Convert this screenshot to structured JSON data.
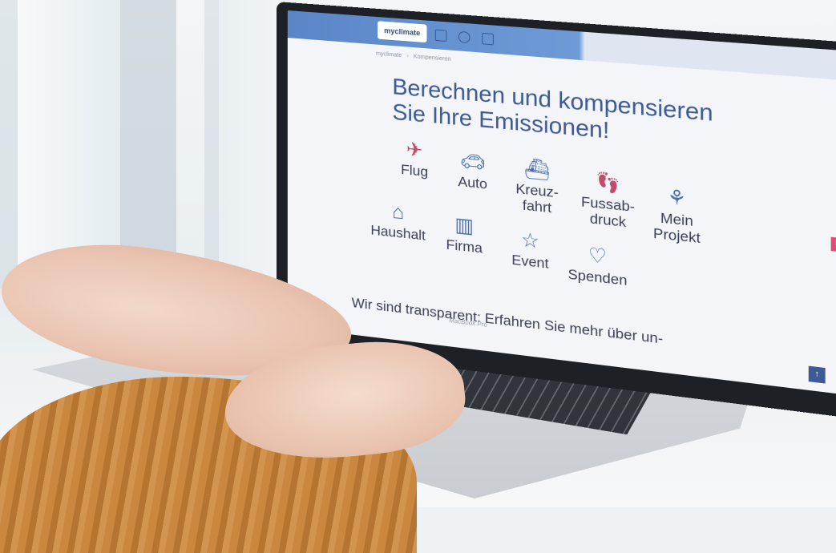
{
  "site": {
    "logo": "myclimate",
    "breadcrumb": [
      "myclimate",
      "Kompensieren"
    ],
    "heading_line1": "Berechnen und kompensieren",
    "heading_line2": "Sie Ihre Emissionen!",
    "categories": [
      {
        "label": "Flug",
        "icon": "airplane-icon"
      },
      {
        "label": "Auto",
        "icon": "car-icon"
      },
      {
        "label": "Kreuz-\nfahrt",
        "icon": "ship-icon"
      },
      {
        "label": "Fussab-\ndruck",
        "icon": "footprint-icon"
      },
      {
        "label": "Mein\nProjekt",
        "icon": "plant-icon"
      },
      {
        "label": "Haushalt",
        "icon": "house-icon"
      },
      {
        "label": "Firma",
        "icon": "factory-icon"
      },
      {
        "label": "Event",
        "icon": "calendar-star-icon"
      },
      {
        "label": "Spenden",
        "icon": "donate-hand-icon"
      }
    ],
    "transparent_text": "Wir sind transparent: Erfahren Sie mehr über un-"
  },
  "device": {
    "brand_label": "MacBook Pro"
  },
  "colors": {
    "accent_blue": "#3d5a94",
    "accent_pink": "#c04d6f"
  }
}
